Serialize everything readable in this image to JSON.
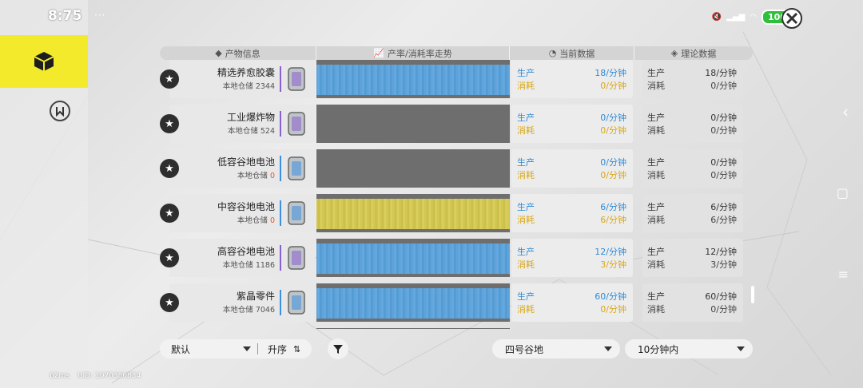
{
  "status": {
    "time": "8:75",
    "battery": "100",
    "ping": "62ms",
    "uid": "UID: 1070386834"
  },
  "header": {
    "col_info": "产物信息",
    "col_trend": "产率/消耗率走势",
    "col_current": "当前数据",
    "col_theory": "理论数据"
  },
  "labels": {
    "produce": "生产",
    "consume": "消耗"
  },
  "rows": [
    {
      "name": "精选养愈胶囊",
      "stock_label": "本地仓储",
      "stock": "2344",
      "cur_prod": "18/分钟",
      "cur_cons": "0/分钟",
      "th_prod": "18/分钟",
      "th_cons": "0/分钟",
      "accent": "#8a5fd0",
      "trend": "blue"
    },
    {
      "name": "工业爆炸物",
      "stock_label": "本地仓储",
      "stock": "524",
      "cur_prod": "0/分钟",
      "cur_cons": "0/分钟",
      "th_prod": "0/分钟",
      "th_cons": "0/分钟",
      "accent": "#8a5fd0",
      "trend": "none"
    },
    {
      "name": "低容谷地电池",
      "stock_label": "本地仓储",
      "stock": "0",
      "cur_prod": "0/分钟",
      "cur_cons": "0/分钟",
      "th_prod": "0/分钟",
      "th_cons": "0/分钟",
      "accent": "#3d8fe0",
      "trend": "none"
    },
    {
      "name": "中容谷地电池",
      "stock_label": "本地仓储",
      "stock": "0",
      "cur_prod": "6/分钟",
      "cur_cons": "6/分钟",
      "th_prod": "6/分钟",
      "th_cons": "6/分钟",
      "accent": "#3d8fe0",
      "trend": "yellow"
    },
    {
      "name": "高容谷地电池",
      "stock_label": "本地仓储",
      "stock": "1186",
      "cur_prod": "12/分钟",
      "cur_cons": "3/分钟",
      "th_prod": "12/分钟",
      "th_cons": "3/分钟",
      "accent": "#8a5fd0",
      "trend": "blue"
    },
    {
      "name": "紫晶零件",
      "stock_label": "本地仓储",
      "stock": "7046",
      "cur_prod": "60/分钟",
      "cur_cons": "0/分钟",
      "th_prod": "60/分钟",
      "th_cons": "0/分钟",
      "accent": "#3d8fe0",
      "trend": "blue"
    }
  ],
  "controls": {
    "sort_default": "默认",
    "sort_order": "升序",
    "region": "四号谷地",
    "time_range": "10分钟内"
  },
  "colors": {
    "accent_yellow": "#f3ea2b",
    "produce_blue": "#2f8bd8",
    "consume_yellow": "#d9a81a"
  }
}
